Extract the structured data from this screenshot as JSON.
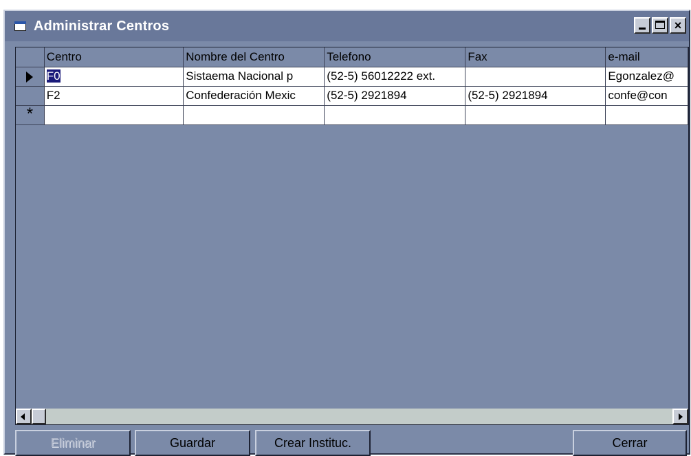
{
  "window": {
    "title": "Administrar Centros",
    "controls": {
      "minimize": "minimize",
      "maximize": "maximize",
      "close": "×"
    }
  },
  "grid": {
    "columns": [
      "Centro",
      "Nombre del Centro",
      "Telefono",
      "Fax",
      "e-mail"
    ],
    "rows": [
      {
        "indicator": "current",
        "centro": "F0",
        "nombre": "Sistaema Nacional p",
        "telefono": "(52-5) 56012222 ext.",
        "fax": "",
        "email": "Egonzalez@"
      },
      {
        "indicator": "",
        "centro": "F2",
        "nombre": "Confederación Mexic",
        "telefono": "(52-5) 2921894",
        "fax": "(52-5) 2921894",
        "email": "confe@con"
      }
    ],
    "new_row_marker": "*"
  },
  "buttons": {
    "eliminar": "Eliminar",
    "guardar": "Guardar",
    "crear": "Crear Instituc.",
    "cerrar": "Cerrar"
  },
  "colors": {
    "window_bg": "#7b8aa8",
    "title_text": "#ffffff",
    "cell_bg": "#ffffff",
    "selection": "#1a1a7a",
    "scrollbar_track": "#c3ccc9"
  }
}
